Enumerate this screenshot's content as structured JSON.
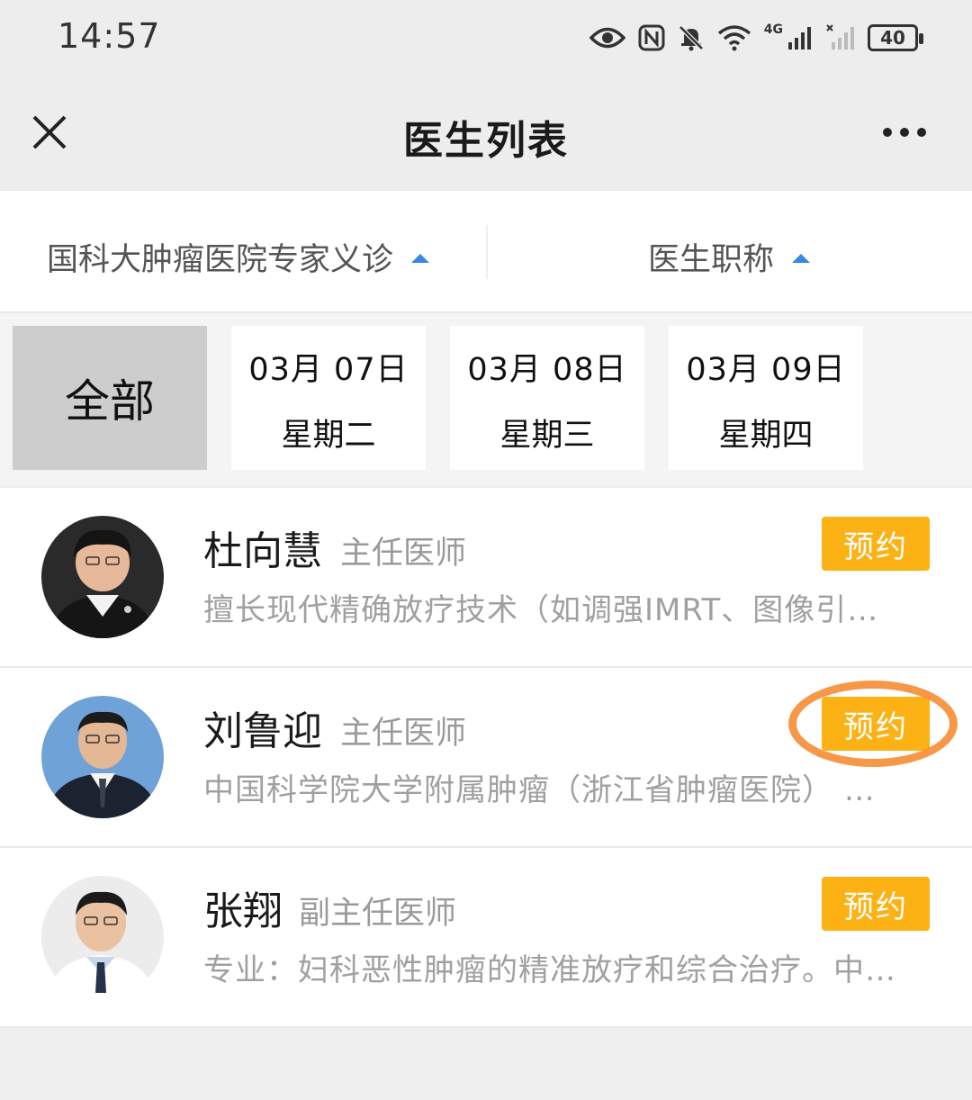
{
  "status_bar": {
    "time": "14:57",
    "network_label": "4G",
    "battery": "40",
    "icons": [
      "eye-icon",
      "nfc-icon",
      "bell-muted-icon",
      "wifi-icon",
      "signal-icon",
      "signal-no-sim-icon",
      "battery-icon"
    ]
  },
  "nav": {
    "title": "医生列表",
    "close_icon": "close-icon",
    "more_icon": "more-icon"
  },
  "filters": {
    "hospital": "国科大肿瘤医院专家义诊",
    "doctor_title": "医生职称",
    "arrow_color": "#3a86e6"
  },
  "date_tabs": {
    "all_label": "全部",
    "dates": [
      {
        "date": "03月 07日",
        "weekday": "星期二"
      },
      {
        "date": "03月 08日",
        "weekday": "星期三"
      },
      {
        "date": "03月 09日",
        "weekday": "星期四"
      }
    ]
  },
  "doctors": [
    {
      "name": "杜向慧",
      "title": "主任医师",
      "description": "擅长现代精确放疗技术（如调强IMRT、图像引…",
      "book_label": "预约"
    },
    {
      "name": "刘鲁迎",
      "title": "主任医师",
      "description": "中国科学院大学附属肿瘤（浙江省肿瘤医院） …",
      "book_label": "预约"
    },
    {
      "name": "张翔",
      "title": "副主任医师",
      "description": "专业：妇科恶性肿瘤的精准放疗和综合治疗。中…",
      "book_label": "预约"
    }
  ],
  "colors": {
    "accent_button": "#fcb215",
    "highlight_ring": "#f68f3a",
    "selected_tab": "#cdcdcd"
  }
}
